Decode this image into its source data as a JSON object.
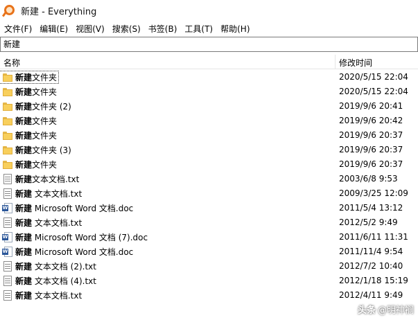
{
  "window": {
    "title": "新建 - Everything"
  },
  "menu": [
    {
      "label": "文件(F)"
    },
    {
      "label": "编辑(E)"
    },
    {
      "label": "视图(V)"
    },
    {
      "label": "搜索(S)"
    },
    {
      "label": "书签(B)"
    },
    {
      "label": "工具(T)"
    },
    {
      "label": "帮助(H)"
    }
  ],
  "search": {
    "value": "新建"
  },
  "columns": {
    "name": "名称",
    "modified": "修改时间"
  },
  "files": [
    {
      "icon": "folder-icon",
      "highlight": "新建",
      "rest": "文件夹",
      "modified": "2020/5/15 22:04",
      "selected": true
    },
    {
      "icon": "folder-icon",
      "highlight": "新建",
      "rest": "文件夹",
      "modified": "2020/5/15 22:04"
    },
    {
      "icon": "folder-icon",
      "highlight": "新建",
      "rest": "文件夹 (2)",
      "modified": "2019/9/6 20:41"
    },
    {
      "icon": "folder-icon",
      "highlight": "新建",
      "rest": "文件夹",
      "modified": "2019/9/6 20:42"
    },
    {
      "icon": "folder-icon",
      "highlight": "新建",
      "rest": "文件夹",
      "modified": "2019/9/6 20:37"
    },
    {
      "icon": "folder-icon",
      "highlight": "新建",
      "rest": "文件夹 (3)",
      "modified": "2019/9/6 20:37"
    },
    {
      "icon": "folder-icon",
      "highlight": "新建",
      "rest": "文件夹",
      "modified": "2019/9/6 20:37"
    },
    {
      "icon": "text-file-icon",
      "highlight": "新建",
      "rest": "文本文档.txt",
      "modified": "2003/6/8 9:53"
    },
    {
      "icon": "text-file-icon",
      "highlight": "新建",
      "rest": " 文本文档.txt",
      "modified": "2009/3/25 12:09"
    },
    {
      "icon": "word-doc-icon",
      "highlight": "新建",
      "rest": " Microsoft Word 文档.doc",
      "modified": "2011/5/4 13:12"
    },
    {
      "icon": "text-file-icon",
      "highlight": "新建",
      "rest": " 文本文档.txt",
      "modified": "2012/5/2 9:49"
    },
    {
      "icon": "word-doc-icon",
      "highlight": "新建",
      "rest": " Microsoft Word 文档 (7).doc",
      "modified": "2011/6/11 11:31"
    },
    {
      "icon": "word-doc-icon",
      "highlight": "新建",
      "rest": " Microsoft Word 文档.doc",
      "modified": "2011/11/4 9:54"
    },
    {
      "icon": "text-file-icon",
      "highlight": "新建",
      "rest": " 文本文档 (2).txt",
      "modified": "2012/7/2 10:40"
    },
    {
      "icon": "text-file-icon",
      "highlight": "新建",
      "rest": " 文本文档 (4).txt",
      "modified": "2012/1/18 15:19"
    },
    {
      "icon": "text-file-icon",
      "highlight": "新建",
      "rest": " 文本文档.txt",
      "modified": "2012/4/11 9:49"
    }
  ],
  "watermark": {
    "brand": "头条",
    "handle": "@明神裥"
  }
}
